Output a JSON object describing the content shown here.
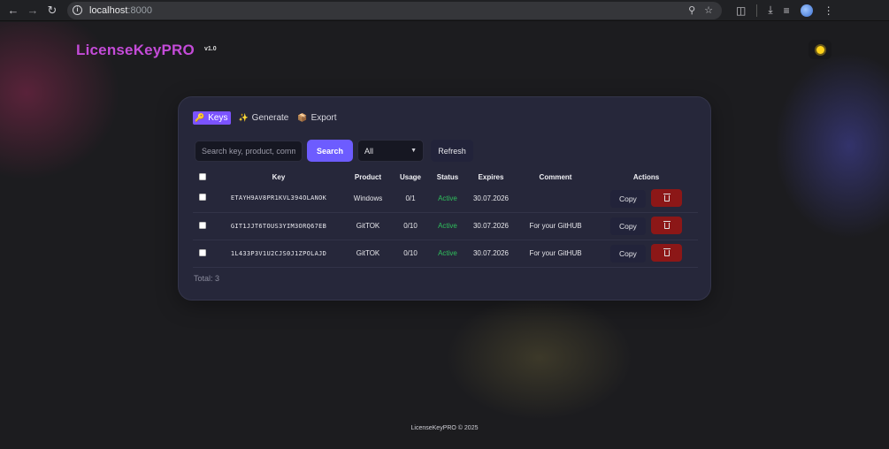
{
  "browser": {
    "url": "localhost",
    "port": ":8000",
    "icons": [
      "back-arrow-icon",
      "forward-arrow-icon",
      "reload-icon",
      "info-icon",
      "zoom-icon",
      "star-icon",
      "extensions-icon",
      "download-icon",
      "media-icon",
      "profile-icon",
      "menu-icon"
    ]
  },
  "header": {
    "brand": "LicenseKeyPRO",
    "version": "v1.0"
  },
  "tabs": [
    {
      "icon": "🔑",
      "label": "Keys",
      "active": true
    },
    {
      "icon": "✨",
      "label": "Generate",
      "active": false
    },
    {
      "icon": "📦",
      "label": "Export",
      "active": false
    }
  ],
  "toolbar": {
    "search_placeholder": "Search key, product, comment",
    "search_label": "Search",
    "filter_selected": "All",
    "refresh_label": "Refresh"
  },
  "table": {
    "columns": [
      "",
      "Key",
      "Product",
      "Usage",
      "Status",
      "Expires",
      "Comment",
      "Actions"
    ],
    "rows": [
      {
        "key": "ETAYH9AV8PR1KVL394OLANOK",
        "product": "Windows",
        "usage": "0/1",
        "status": "Active",
        "expires": "30.07.2026",
        "comment": ""
      },
      {
        "key": "GIT1JJT6TOUS3YIM3ORQ67EB",
        "product": "GitTOK",
        "usage": "0/10",
        "status": "Active",
        "expires": "30.07.2026",
        "comment": "For your GitHUB"
      },
      {
        "key": "1L433P3V1U2CJS0J1ZPOLAJD",
        "product": "GitTOK",
        "usage": "0/10",
        "status": "Active",
        "expires": "30.07.2026",
        "comment": "For your GitHUB"
      }
    ],
    "copy_label": "Copy"
  },
  "total_text": "Total: 3",
  "footer": "LicenseKeyPRO © 2025",
  "colors": {
    "brand": "#c44bd8",
    "accent": "#6d5cff",
    "status_active": "#2fbf5c",
    "danger": "#8c1717"
  }
}
